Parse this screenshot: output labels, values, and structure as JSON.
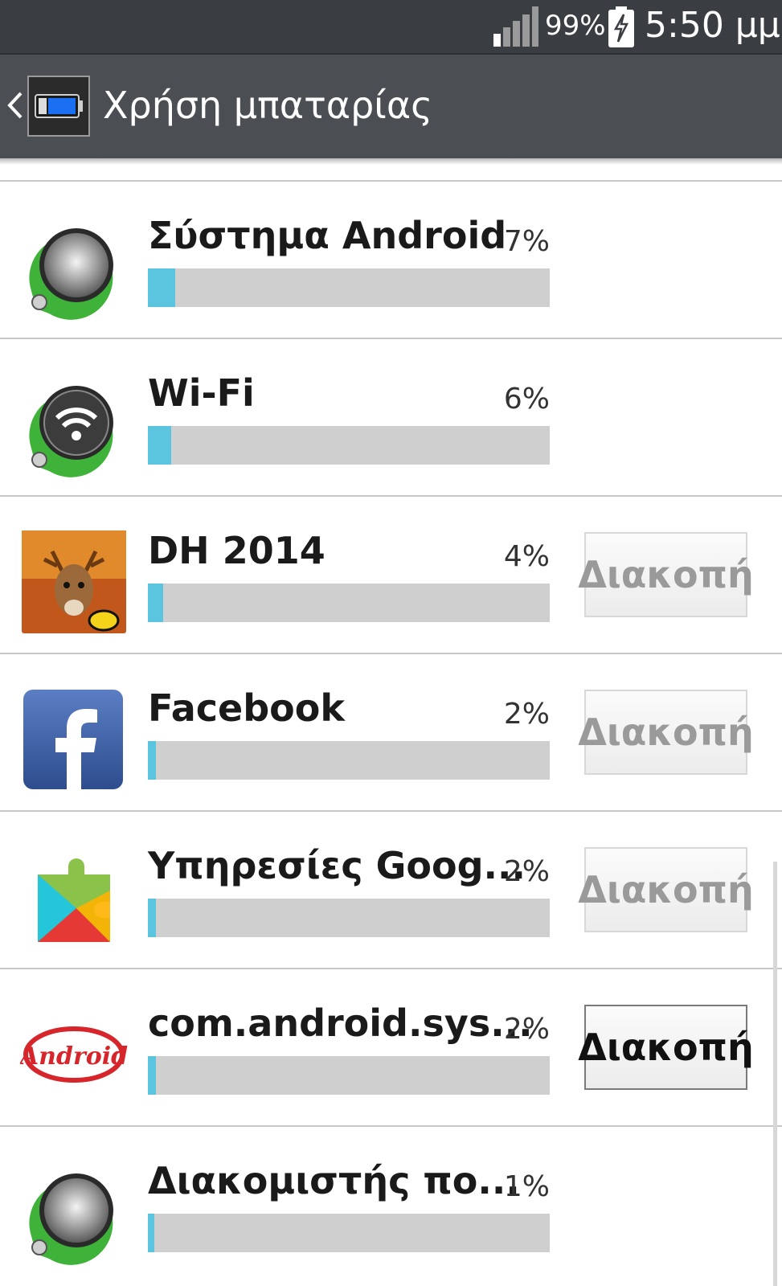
{
  "status_bar": {
    "battery_percent": "99%",
    "time": "5:50 μμ",
    "signal_icon": "signal-bars-icon",
    "battery_icon": "battery-charging-icon"
  },
  "action_bar": {
    "title": "Χρήση μπαταρίας",
    "back_icon": "chevron-left-icon",
    "app_icon": "battery-app-icon"
  },
  "items": [
    {
      "name": "Σύστημα Android",
      "percent": "7%",
      "usage": 0.07,
      "icon": "android-system-gear-icon",
      "stop_label": "",
      "stop_enabled": false
    },
    {
      "name": "Wi-Fi",
      "percent": "6%",
      "usage": 0.06,
      "icon": "wifi-icon",
      "stop_label": "",
      "stop_enabled": false
    },
    {
      "name": "DH 2014",
      "percent": "4%",
      "usage": 0.04,
      "icon": "deer-hunter-icon",
      "stop_label": "Διακοπή",
      "stop_enabled": false
    },
    {
      "name": "Facebook",
      "percent": "2%",
      "usage": 0.02,
      "icon": "facebook-icon",
      "stop_label": "Διακοπή",
      "stop_enabled": false
    },
    {
      "name": "Υπηρεσίες Goog...",
      "percent": "2%",
      "usage": 0.02,
      "icon": "google-play-services-icon",
      "stop_label": "Διακοπή",
      "stop_enabled": false
    },
    {
      "name": "com.android.sys...",
      "percent": "2%",
      "usage": 0.02,
      "icon": "android-kitkat-logo-icon",
      "stop_label": "Διακοπή",
      "stop_enabled": true
    },
    {
      "name": "Διακομιστής πο...",
      "percent": "1%",
      "usage": 0.01,
      "icon": "media-server-gear-icon",
      "stop_label": "",
      "stop_enabled": false
    }
  ],
  "colors": {
    "bar_fill": "#5bc5e0",
    "bar_track": "#cfcfcf",
    "header": "#4b4e53"
  }
}
